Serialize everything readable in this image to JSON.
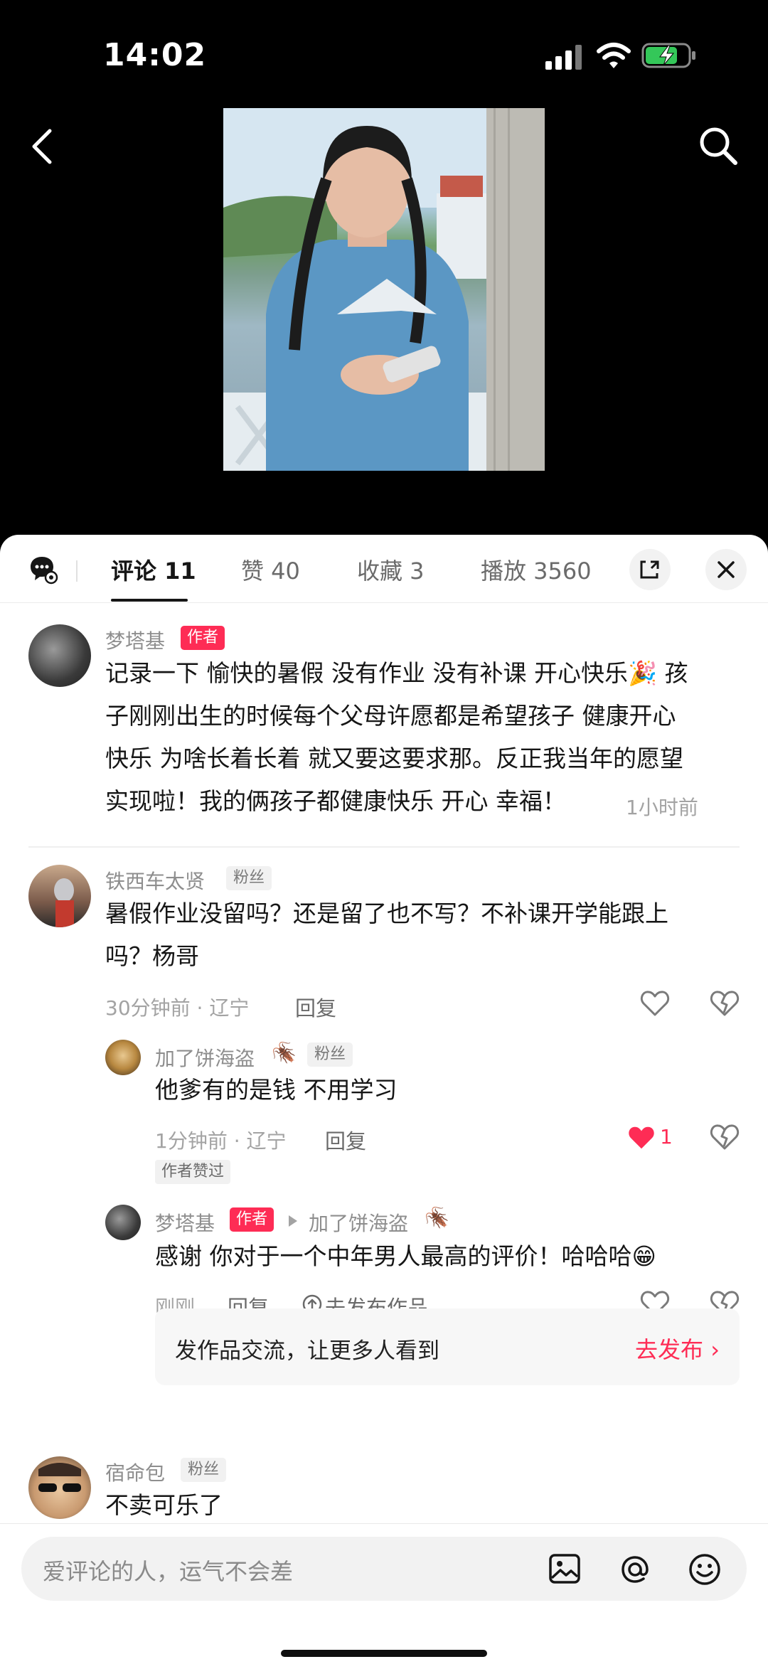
{
  "status_bar": {
    "time": "14:02"
  },
  "tabs": {
    "comments": "评论 11",
    "likes": "赞 40",
    "favorites": "收藏 3",
    "plays": "播放 3560"
  },
  "comments": [
    {
      "name": "梦塔基",
      "badge": "作者",
      "lines": [
        "记录一下 愉快的暑假 没有作业 没有补课 开心快乐🎉 孩",
        "子刚刚出生的时候每个父母许愿都是希望孩子 健康开心",
        "快乐 为啥长着长着 就又要这要求那。反正我当年的愿望",
        "实现啦！我的俩孩子都健康快乐 开心 幸福！"
      ],
      "time": "1小时前"
    },
    {
      "name": "铁西车太贤",
      "badge": "粉丝",
      "lines": [
        "暑假作业没留吗？还是留了也不写？不补课开学能跟上",
        "吗？杨哥"
      ],
      "time": "30分钟前 · 辽宁",
      "reply": "回复"
    },
    {
      "name": "加了饼海盗",
      "name_emoji": "🪳",
      "badge": "粉丝",
      "text": "他爹有的是钱 不用学习",
      "time": "1分钟前 · 辽宁",
      "reply": "回复",
      "like_count": "1",
      "author_liked": "作者赞过"
    },
    {
      "name": "梦塔基",
      "badge": "作者",
      "reply_to": "加了饼海盗",
      "reply_to_emoji": "🪳",
      "text": "感谢 你对于一个中年男人最高的评价！哈哈哈😁",
      "time": "刚刚",
      "reply": "回复",
      "publish": "去发布作品"
    },
    {
      "name": "宿命包",
      "badge": "粉丝",
      "text": "不卖可乐了"
    }
  ],
  "promo": {
    "text": "发作品交流，让更多人看到",
    "link": "去发布 ›"
  },
  "input": {
    "placeholder": "爱评论的人，运气不会差"
  },
  "colors": {
    "accent": "#fe2c55"
  }
}
